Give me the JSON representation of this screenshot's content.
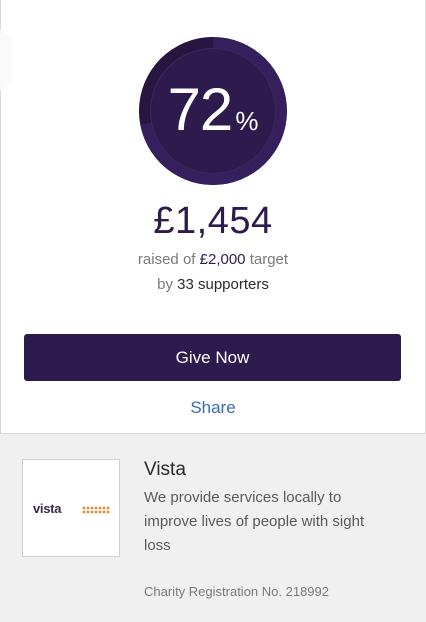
{
  "progress": {
    "percent": 72,
    "percent_label": "72",
    "percent_sign": "%"
  },
  "fundraising": {
    "amount_raised": "£1,454",
    "raised_prefix": "raised of",
    "target": "£2,000",
    "target_suffix": "target",
    "supporters_prefix": "by",
    "supporters_count": "33 supporters"
  },
  "actions": {
    "give_label": "Give Now",
    "share_label": "Share"
  },
  "charity": {
    "logo_text": "vista",
    "name": "Vista",
    "description": "We provide services locally to improve lives of people with sight loss",
    "registration": "Charity Registration No. 218992"
  },
  "colors": {
    "brand": "#2d1b4e",
    "link": "#3a6cb0",
    "logo_accent": "#e98a2b"
  }
}
